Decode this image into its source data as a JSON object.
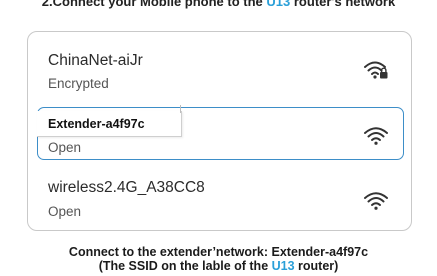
{
  "header": {
    "title_before": "2.Connect your Mobile phone to the ",
    "title_brand": "U13",
    "title_after": " router's network"
  },
  "networks": [
    {
      "ssid": "ChinaNet-aiJr",
      "status": "Encrypted",
      "icon": "wifi-lock-icon"
    },
    {
      "ssid": "Extender-a4f97c",
      "status": "Open",
      "icon": "wifi-icon",
      "selected": true
    },
    {
      "ssid": "wireless2.4G_A38CC8",
      "status": "Open",
      "icon": "wifi-icon"
    }
  ],
  "caption": {
    "line1": "Connect to the extender’network: Extender-a4f97c",
    "line2_before": "(The SSID on the lable of the ",
    "line2_brand": "U13",
    "line2_after": " router)"
  },
  "colors": {
    "accent": "#2a9fd8",
    "selected_border": "#3d8ec8",
    "panel_border": "#c9c9c9"
  }
}
